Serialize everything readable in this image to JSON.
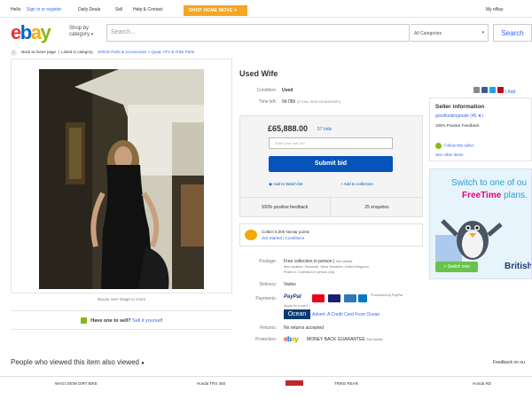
{
  "topbar": {
    "greeting": "Hello.",
    "signin": "Sign in or register",
    "daily_deals": "Daily Deals",
    "sell": "Sell",
    "help": "Help & Contact",
    "promo": "SHOP HOME MOVE >",
    "my_ebay": "My eBay"
  },
  "header": {
    "logo_letters": [
      "e",
      "b",
      "a",
      "y"
    ],
    "logo_colors": [
      "#e53238",
      "#0064d2",
      "#f5af02",
      "#86b817"
    ],
    "shop_by": "Shop by category",
    "search_placeholder": "Search...",
    "category": "All Categories",
    "search_button": "Search"
  },
  "breadcrumb": {
    "back": "Back to home page",
    "listed": "Listed in category:",
    "path": "Vehicle Parts & Accessories > Quad, ATV & Trike Parts"
  },
  "image": {
    "caption": "Mouse over image to zoom"
  },
  "sell_prompt": {
    "text": "Have one to sell?",
    "link": "Sell it yourself"
  },
  "item": {
    "title": "Used Wife",
    "condition_label": "Condition:",
    "condition": "Used",
    "timeleft_label": "Time left:",
    "timeleft": "9d 05h",
    "timeleft_detail": "(17 Dec, 2019   22:16:03 BST)",
    "price": "£65,888.00",
    "bids": "57 bids",
    "bid_placeholder": "Enter your max bid",
    "submit": "Submit bid",
    "watch": "Add to Watch list",
    "collection": "Add to collection",
    "positive_feedback": "100% positive feedback",
    "enquiries": "25 enquiries"
  },
  "nectar": {
    "line1": "Collect 5,000 Nectar points",
    "line2": "Get Started | Conditions"
  },
  "details": {
    "postage_label": "Postage:",
    "postage": "Free collection in person |",
    "postage_link": "See details",
    "item_location": "Item location:  Horsforth, West Yorkshire, United Kingdom",
    "postage_to": "Posts to:  Collection in person only",
    "delivery_label": "Delivery:",
    "delivery": "Varies",
    "payments_label": "Payments:",
    "paypal": "PayPal",
    "processed_by": "Processed by PayPal",
    "apply": "Apply for a card >",
    "ocean_label": "Ocean",
    "ocean_advert": "Advert: A Credit Card From Ocean",
    "returns_label": "Returns:",
    "returns": "No returns accepted",
    "protection_label": "Protection:",
    "protection": "MONEY BACK GUARANTEE",
    "protection_link": "See details"
  },
  "seller": {
    "heading": "Seller information",
    "name": "goodlookingmale (45 ★)",
    "feedback": "100% Positive Feedback",
    "follow": "Follow this seller",
    "other_items": "See other items"
  },
  "ad": {
    "line1": "Switch to one of ou",
    "line2a": "FreeTime",
    "line2b": " plans.",
    "button": "> Switch now",
    "brand": "British"
  },
  "bottom": {
    "viewed_title": "People who viewed this item also viewed",
    "feedback": "Feedback on ou",
    "thumbs": [
      "WAGI 200W DIRT BIKE",
      "Honda TRX 450",
      "TRIKE REAR",
      "Honda RD"
    ]
  },
  "colors": {
    "link": "#3665f3",
    "submit": "#0654ba",
    "promo": "#f5a623"
  }
}
